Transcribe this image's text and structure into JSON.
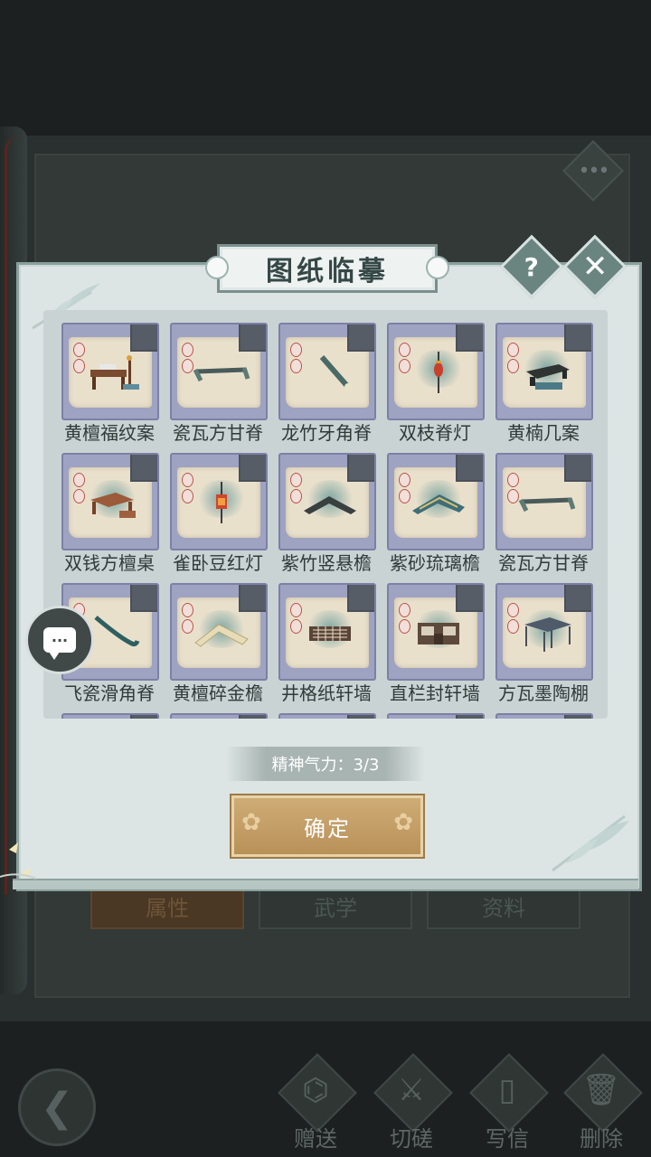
{
  "dialog": {
    "title": "图纸临摹",
    "help_icon": "?",
    "close_icon": "✕",
    "stamina": "精神气力：3/3",
    "confirm_label": "确定",
    "items": [
      {
        "label": "黄檀福纹案",
        "icon": "desk-icon"
      },
      {
        "label": "瓷瓦方甘脊",
        "icon": "ridge-icon"
      },
      {
        "label": "龙竹牙角脊",
        "icon": "horn-ridge-icon"
      },
      {
        "label": "双枝脊灯",
        "icon": "lantern-icon"
      },
      {
        "label": "黄楠几案",
        "icon": "table-icon"
      },
      {
        "label": "双钱方檀桌",
        "icon": "square-table-icon"
      },
      {
        "label": "雀卧豆红灯",
        "icon": "red-lantern-icon"
      },
      {
        "label": "紫竹竖悬檐",
        "icon": "eave-icon"
      },
      {
        "label": "紫砂琉璃檐",
        "icon": "glazed-eave-icon"
      },
      {
        "label": "瓷瓦方甘脊",
        "icon": "ridge-icon"
      },
      {
        "label": "飞瓷滑角脊",
        "icon": "curved-ridge-icon"
      },
      {
        "label": "黄檀碎金檐",
        "icon": "gold-eave-icon"
      },
      {
        "label": "井格纸轩墙",
        "icon": "lattice-wall-icon"
      },
      {
        "label": "直栏封轩墙",
        "icon": "rail-wall-icon"
      },
      {
        "label": "方瓦墨陶棚",
        "icon": "pavilion-icon"
      }
    ]
  },
  "background": {
    "tabs": [
      "属性",
      "武学",
      "资料"
    ],
    "more_icon": "•••"
  },
  "bottom_nav": {
    "back_icon": "❮",
    "items": [
      {
        "label": "赠送",
        "icon": "scroll-icon"
      },
      {
        "label": "切磋",
        "icon": "sword-icon"
      },
      {
        "label": "写信",
        "icon": "letter-icon"
      },
      {
        "label": "删除",
        "icon": "trash-icon"
      }
    ]
  },
  "chat_icon": "..."
}
